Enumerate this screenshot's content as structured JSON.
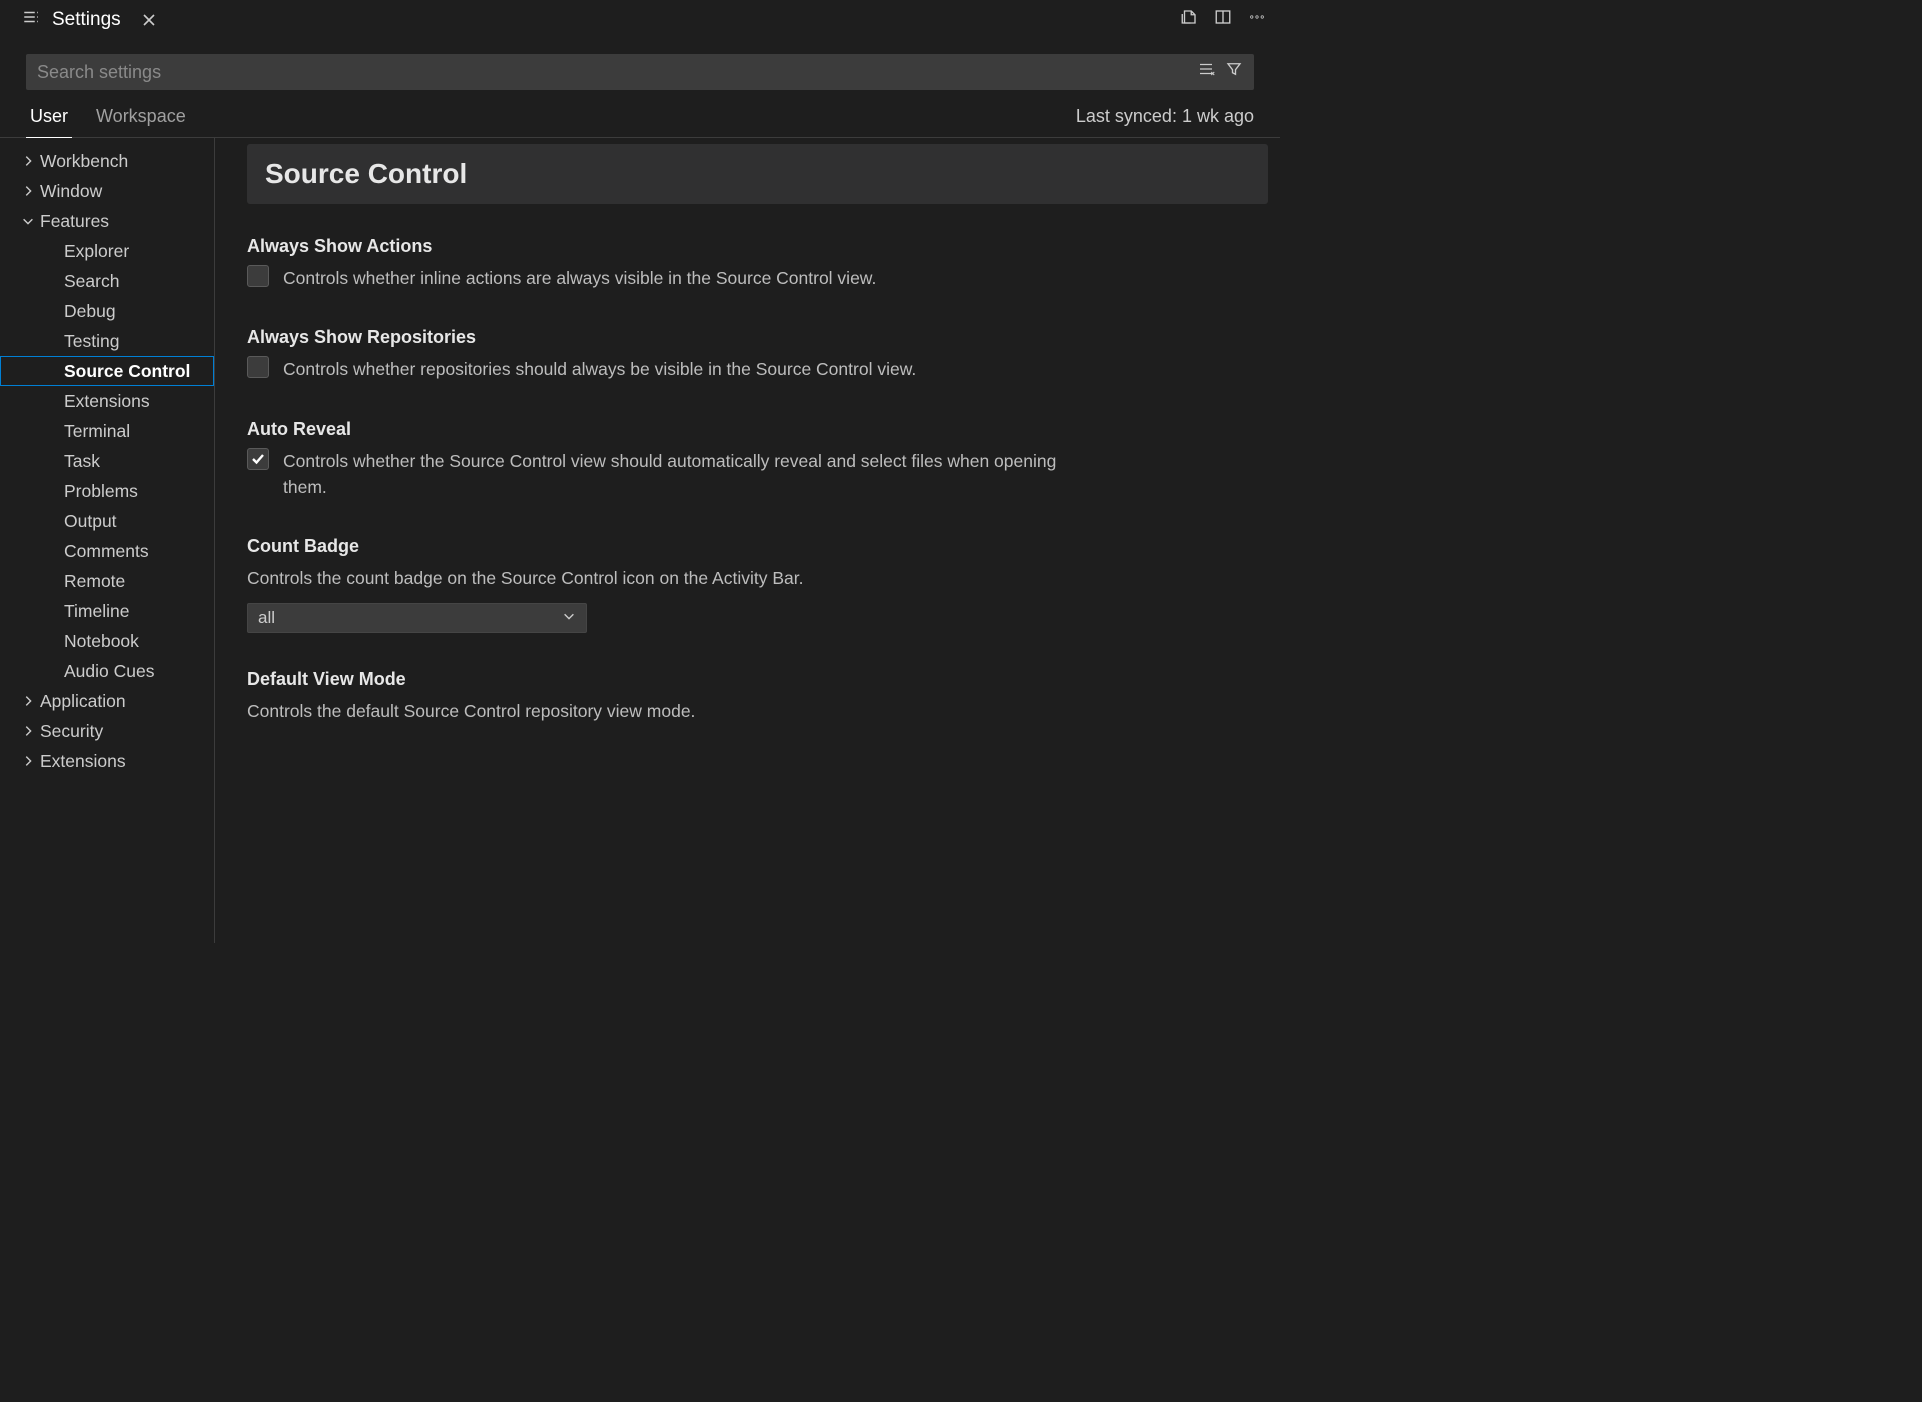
{
  "tab": {
    "title": "Settings"
  },
  "search": {
    "placeholder": "Search settings"
  },
  "scopes": {
    "user": "User",
    "workspace": "Workspace"
  },
  "sync_status": "Last synced: 1 wk ago",
  "sidebar": {
    "items": [
      {
        "label": "Workbench",
        "level": 1,
        "chevron": "right"
      },
      {
        "label": "Window",
        "level": 1,
        "chevron": "right"
      },
      {
        "label": "Features",
        "level": 1,
        "chevron": "down"
      },
      {
        "label": "Explorer",
        "level": 2
      },
      {
        "label": "Search",
        "level": 2
      },
      {
        "label": "Debug",
        "level": 2
      },
      {
        "label": "Testing",
        "level": 2
      },
      {
        "label": "Source Control",
        "level": 2,
        "selected": true
      },
      {
        "label": "Extensions",
        "level": 2
      },
      {
        "label": "Terminal",
        "level": 2
      },
      {
        "label": "Task",
        "level": 2
      },
      {
        "label": "Problems",
        "level": 2
      },
      {
        "label": "Output",
        "level": 2
      },
      {
        "label": "Comments",
        "level": 2
      },
      {
        "label": "Remote",
        "level": 2
      },
      {
        "label": "Timeline",
        "level": 2
      },
      {
        "label": "Notebook",
        "level": 2
      },
      {
        "label": "Audio Cues",
        "level": 2
      },
      {
        "label": "Application",
        "level": 1,
        "chevron": "right"
      },
      {
        "label": "Security",
        "level": 1,
        "chevron": "right"
      },
      {
        "label": "Extensions",
        "level": 1,
        "chevron": "right"
      }
    ]
  },
  "content": {
    "section_title": "Source Control",
    "settings": [
      {
        "key": "always-show-actions",
        "title": "Always Show Actions",
        "type": "checkbox",
        "checked": false,
        "desc": "Controls whether inline actions are always visible in the Source Control view."
      },
      {
        "key": "always-show-repositories",
        "title": "Always Show Repositories",
        "type": "checkbox",
        "checked": false,
        "desc": "Controls whether repositories should always be visible in the Source Control view."
      },
      {
        "key": "auto-reveal",
        "title": "Auto Reveal",
        "type": "checkbox",
        "checked": true,
        "desc": "Controls whether the Source Control view should automatically reveal and select files when opening them."
      },
      {
        "key": "count-badge",
        "title": "Count Badge",
        "type": "select",
        "desc": "Controls the count badge on the Source Control icon on the Activity Bar.",
        "value": "all"
      },
      {
        "key": "default-view-mode",
        "title": "Default View Mode",
        "type": "select",
        "desc": "Controls the default Source Control repository view mode.",
        "value": ""
      }
    ]
  }
}
